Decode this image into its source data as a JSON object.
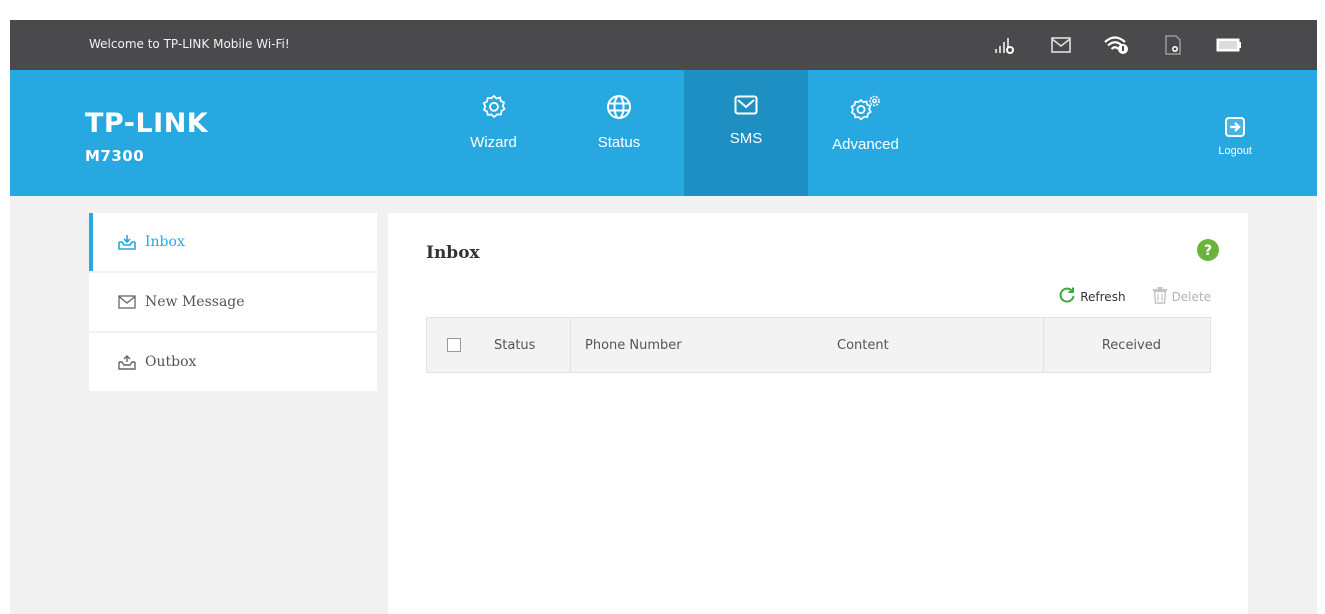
{
  "topbar": {
    "welcome": "Welcome to TP-LINK Mobile Wi-Fi!",
    "icons": [
      "signal-icon",
      "message-icon",
      "wifi-icon",
      "sim-card-icon",
      "battery-icon"
    ]
  },
  "brand": {
    "logo": "TP-LINK",
    "model": "M7300"
  },
  "nav": {
    "items": [
      {
        "label": "Wizard",
        "icon": "gear-icon"
      },
      {
        "label": "Status",
        "icon": "globe-icon"
      },
      {
        "label": "SMS",
        "icon": "envelope-icon"
      },
      {
        "label": "Advanced",
        "icon": "gears-icon"
      }
    ],
    "active": "SMS",
    "logout": "Logout"
  },
  "sidebar": {
    "items": [
      {
        "label": "Inbox",
        "icon": "inbox-icon"
      },
      {
        "label": "New Message",
        "icon": "envelope-icon"
      },
      {
        "label": "Outbox",
        "icon": "outbox-icon"
      }
    ],
    "active": "Inbox"
  },
  "panel": {
    "title": "Inbox",
    "refresh": "Refresh",
    "delete": "Delete",
    "columns": [
      "Status",
      "Phone Number",
      "Content",
      "Received"
    ]
  },
  "colors": {
    "accent": "#27a8e0",
    "active_nav": "#1e8fc2",
    "topbar": "#4a4a4d",
    "help": "#6cb33e",
    "refresh": "#3caa3c"
  }
}
